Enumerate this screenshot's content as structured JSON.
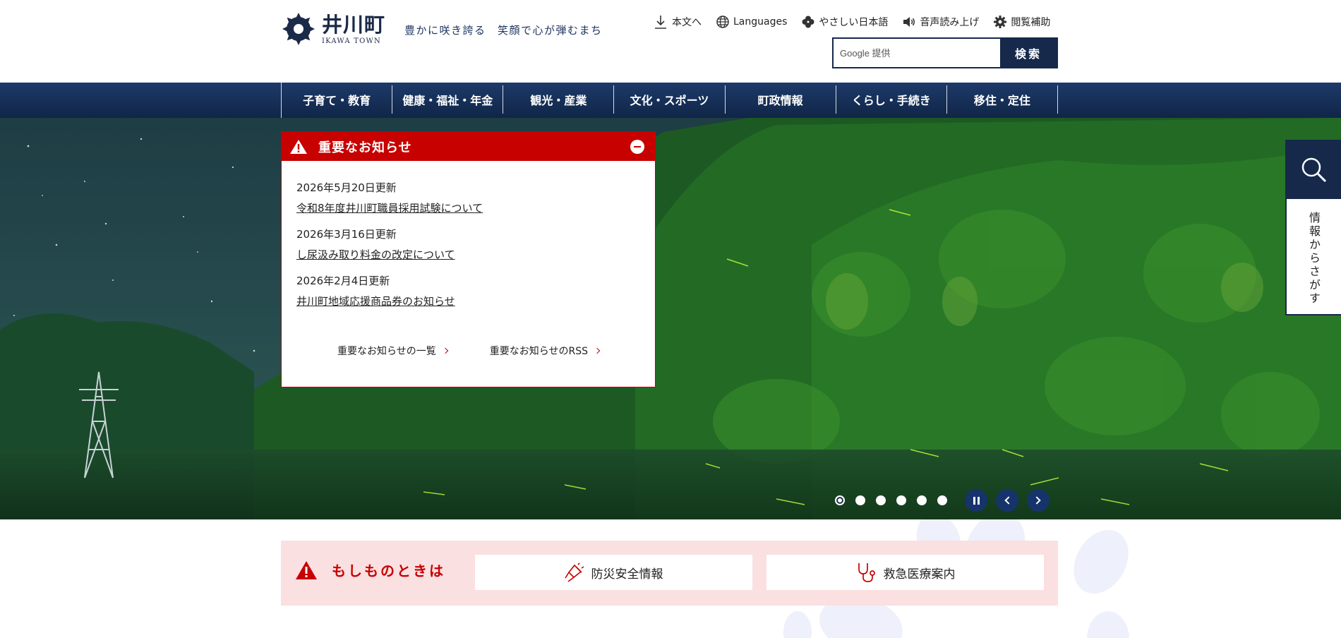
{
  "header": {
    "logo_jp": "井川町",
    "logo_en": "IKAWA TOWN",
    "tagline": "豊かに咲き誇る　笑顔で心が弾むまち",
    "utility": [
      {
        "label": "本文へ",
        "icon": "download-arrow-icon"
      },
      {
        "label": "Languages",
        "icon": "globe-icon"
      },
      {
        "label": "やさしい日本語",
        "icon": "clover-icon"
      },
      {
        "label": "音声読み上げ",
        "icon": "speaker-icon"
      },
      {
        "label": "閲覧補助",
        "icon": "gear-icon"
      }
    ],
    "search": {
      "placeholder": "Google 提供",
      "button": "検索"
    }
  },
  "nav": {
    "items": [
      "子育て・教育",
      "健康・福祉・年金",
      "観光・産業",
      "文化・スポーツ",
      "町政情報",
      "くらし・手続き",
      "移住・定住"
    ]
  },
  "notice": {
    "title": "重要なお知らせ",
    "items": [
      {
        "date": "2026年5月20日更新",
        "link": "令和8年度井川町職員採用試験について"
      },
      {
        "date": "2026年3月16日更新",
        "link": "し尿汲み取り料金の改定について"
      },
      {
        "date": "2026年2月4日更新",
        "link": "井川町地域応援商品券のお知らせ"
      }
    ],
    "list_link": "重要なお知らせの一覧",
    "rss_link": "重要なお知らせのRSS"
  },
  "slider": {
    "slide_count": 6,
    "active_slide": 1
  },
  "sidetab": {
    "label": "情報からさがす"
  },
  "emergency": {
    "title": "もしものときは",
    "buttons": [
      "防災安全情報",
      "救急医療案内"
    ]
  },
  "colors": {
    "navy": "#16294b",
    "alert_red": "#c70000",
    "emergency_bg": "#fae0e1"
  }
}
